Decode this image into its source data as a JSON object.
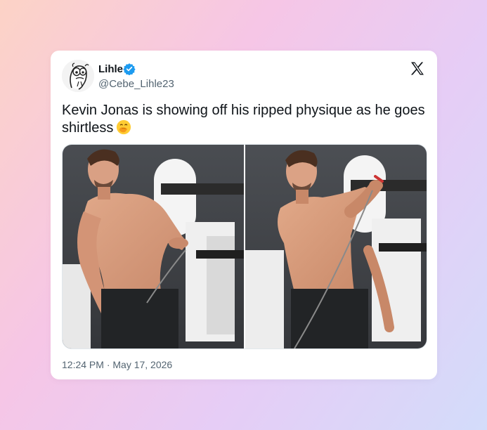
{
  "post": {
    "author": {
      "name": "Lihle",
      "handle": "@Cebe_Lihle23",
      "verified": true,
      "avatar_icon": "cartoon-avatar"
    },
    "platform_icon": "x-logo-icon",
    "text": "Kevin Jonas is showing off his ripped physique as he goes shirtless",
    "emoji": "face-with-hand-over-mouth",
    "media": [
      {
        "description_icon": "gym-photo-left"
      },
      {
        "description_icon": "gym-photo-right"
      }
    ],
    "timestamp": "12:24 PM · May 17, 2026"
  },
  "colors": {
    "verified_blue": "#1d9bf0",
    "text_primary": "#0f1419",
    "text_secondary": "#536471"
  }
}
